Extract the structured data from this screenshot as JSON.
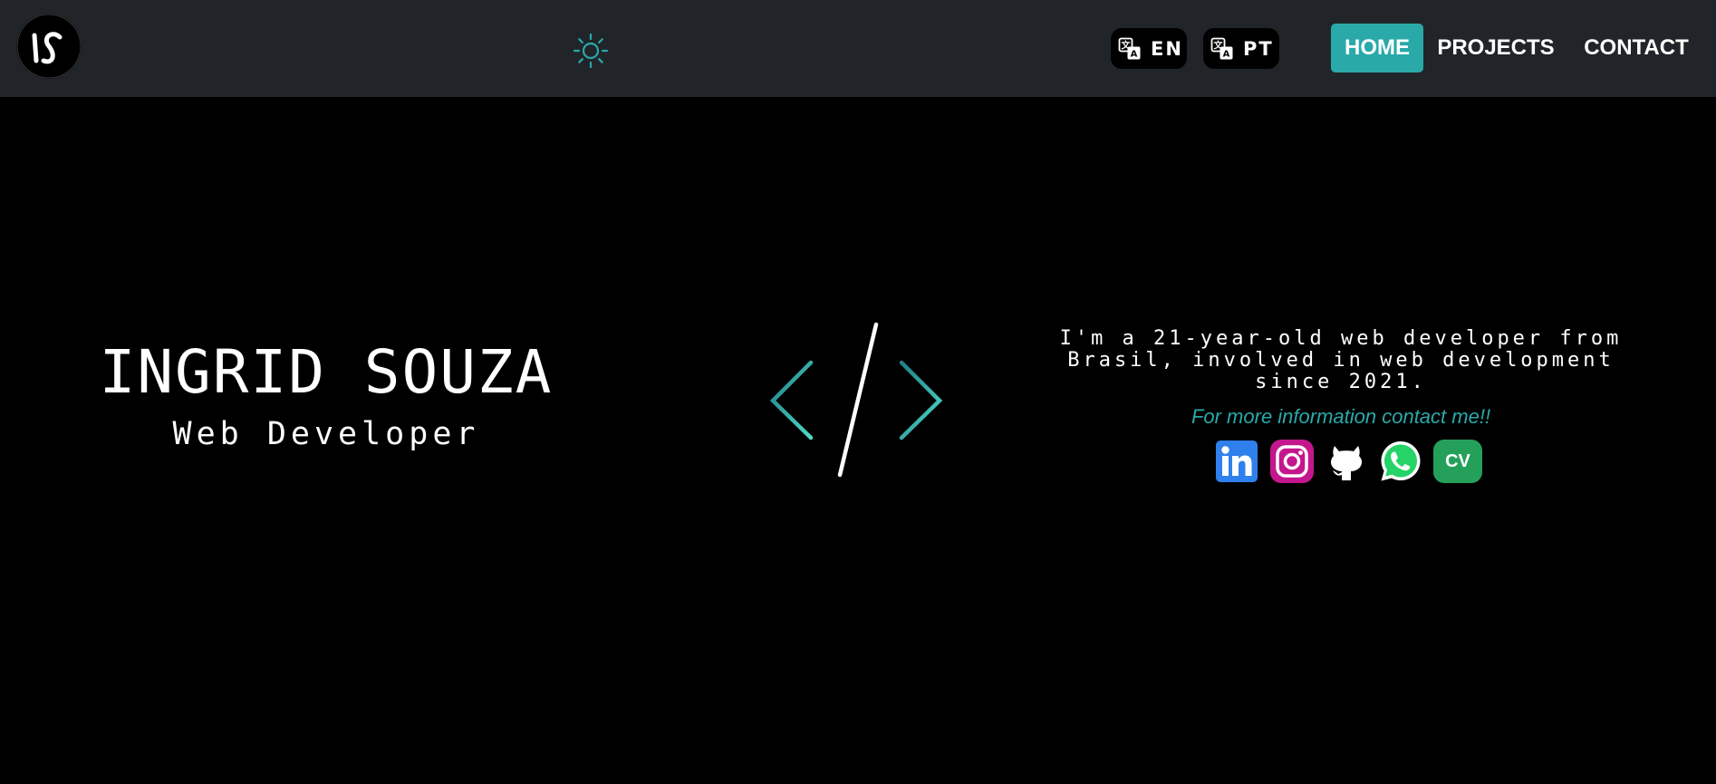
{
  "header": {
    "logo_text": "IS",
    "theme_icon": "sun-icon",
    "languages": [
      {
        "code": "EN",
        "icon": "translate-icon"
      },
      {
        "code": "PT",
        "icon": "translate-icon"
      }
    ],
    "nav": [
      {
        "label": "HOME",
        "active": true
      },
      {
        "label": "PROJECTS",
        "active": false
      },
      {
        "label": "CONTACT",
        "active": false
      }
    ]
  },
  "hero": {
    "name": "INGRID SOUZA",
    "role": "Web Developer",
    "code_symbol_icon": "code-brackets-icon",
    "about_lines": [
      "I'm a 21-year-old web developer from",
      "Brasil, involved in web development",
      "since 2021."
    ],
    "contact_cta": "For more information contact me!!",
    "social": [
      {
        "name": "LinkedIn",
        "icon": "linkedin-icon"
      },
      {
        "name": "Instagram",
        "icon": "instagram-icon"
      },
      {
        "name": "GitHub",
        "icon": "github-icon"
      },
      {
        "name": "WhatsApp",
        "icon": "whatsapp-icon"
      },
      {
        "name": "CV",
        "label": "CV"
      }
    ]
  },
  "colors": {
    "navbar_bg": "#212529",
    "page_bg": "#000000",
    "accent": "#2aa9a9",
    "linkedin": "#2f80ed",
    "instagram": "#c4178d",
    "whatsapp": "#25d366",
    "cv": "#25a05a"
  }
}
